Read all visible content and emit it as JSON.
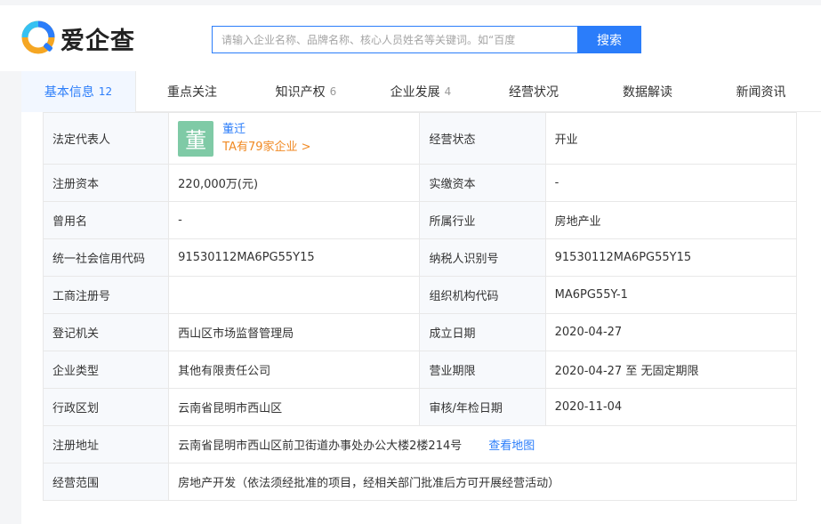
{
  "brand": {
    "name": "爱企查",
    "primary": "#2b7dfa"
  },
  "search": {
    "placeholder": "请输入企业名称、品牌名称、核心人员姓名等关键词。如“百度",
    "button": "搜索"
  },
  "tabs": [
    {
      "label": "基本信息",
      "count": "12",
      "active": true
    },
    {
      "label": "重点关注",
      "count": ""
    },
    {
      "label": "知识产权",
      "count": "6"
    },
    {
      "label": "企业发展",
      "count": "4"
    },
    {
      "label": "经营状况",
      "count": ""
    },
    {
      "label": "数据解读",
      "count": ""
    },
    {
      "label": "新闻资讯",
      "count": ""
    }
  ],
  "info": {
    "legal_rep": {
      "label": "法定代表人",
      "avatar_char": "董",
      "name": "董迁",
      "more": "TA有79家企业 >"
    },
    "status": {
      "label": "经营状态",
      "value": "开业"
    },
    "reg_capital": {
      "label": "注册资本",
      "value": "220,000万(元)"
    },
    "paid_capital": {
      "label": "实缴资本",
      "value": "-"
    },
    "former_name": {
      "label": "曾用名",
      "value": "-"
    },
    "industry": {
      "label": "所属行业",
      "value": "房地产业"
    },
    "credit_code": {
      "label": "统一社会信用代码",
      "value": "91530112MA6PG55Y15"
    },
    "tax_id": {
      "label": "纳税人识别号",
      "value": "91530112MA6PG55Y15"
    },
    "biz_reg_no": {
      "label": "工商注册号",
      "value": ""
    },
    "org_code": {
      "label": "组织机构代码",
      "value": "MA6PG55Y-1"
    },
    "reg_authority": {
      "label": "登记机关",
      "value": "西山区市场监督管理局"
    },
    "found_date": {
      "label": "成立日期",
      "value": "2020-04-27"
    },
    "company_type": {
      "label": "企业类型",
      "value": "其他有限责任公司"
    },
    "biz_term": {
      "label": "营业期限",
      "value": "2020-04-27 至 无固定期限"
    },
    "region": {
      "label": "行政区划",
      "value": "云南省昆明市西山区"
    },
    "audit_date": {
      "label": "审核/年检日期",
      "value": "2020-11-04"
    },
    "address": {
      "label": "注册地址",
      "value": "云南省昆明市西山区前卫街道办事处办公大楼2楼214号",
      "map_link": "查看地图"
    },
    "scope": {
      "label": "经营范围",
      "value": "房地产开发（依法须经批准的项目，经相关部门批准后方可开展经营活动）"
    }
  }
}
